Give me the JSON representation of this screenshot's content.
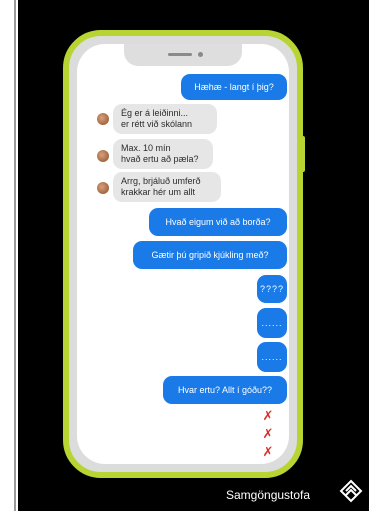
{
  "chat": {
    "messages": [
      {
        "side": "out",
        "text": "Hæhæ - langt í þig?"
      },
      {
        "side": "in",
        "line1": "Ég er á leiðinni...",
        "line2": "er rétt við skólann"
      },
      {
        "side": "in",
        "line1": "Max. 10 mín",
        "line2": "hvað ertu að pæla?"
      },
      {
        "side": "in",
        "line1": "Arrg, brjáluð umferð",
        "line2": "krakkar hér um allt"
      },
      {
        "side": "out",
        "text": "Hvað eigum við að borða?"
      },
      {
        "side": "out",
        "text": "Gætir þú gripið kjúkling með?"
      },
      {
        "side": "out",
        "text": "????"
      },
      {
        "side": "out",
        "text": "......"
      },
      {
        "side": "out",
        "text": "......"
      },
      {
        "side": "out",
        "text": "Hvar ertu? Allt í góðu??"
      }
    ],
    "reaction_icons": [
      "broken-heart-icon",
      "broken-heart-icon",
      "broken-heart-icon"
    ]
  },
  "brand": {
    "name": "Samgöngustofa"
  },
  "colors": {
    "outgoing": "#1a7be8",
    "incoming": "#e6e6e6",
    "phone_frame": "#b8d433",
    "heart": "#d9302a"
  }
}
